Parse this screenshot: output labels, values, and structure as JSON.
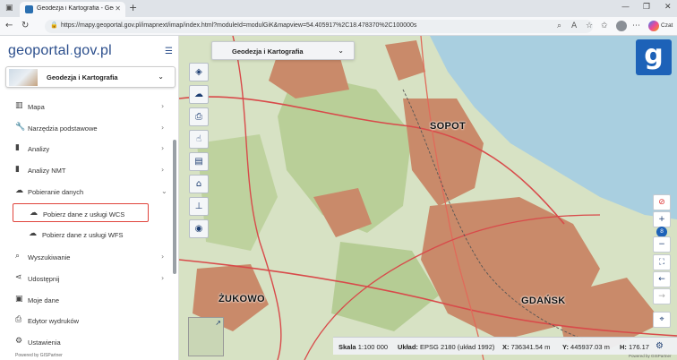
{
  "browser": {
    "tab_title": "Geodezja i Kartografia - Geoportal",
    "url": "https://mapy.geoportal.gov.pl/imapnext/imap/index.html?moduleId=modulGiK&mapview=54.405917%2C18.478370%2C100000s",
    "copilot_label": "Czat"
  },
  "sidebar": {
    "logo": {
      "main": "geoportal",
      "dot": ".",
      "rest": "gov.pl"
    },
    "profile_label": "Geodezja i Kartografia",
    "items": [
      {
        "label": "Mapa",
        "icon": "map-icon"
      },
      {
        "label": "Narzędzia podstawowe",
        "icon": "wrench-icon"
      },
      {
        "label": "Analizy",
        "icon": "bar-chart-icon"
      },
      {
        "label": "Analizy NMT",
        "icon": "bar-chart-icon"
      },
      {
        "label": "Pobieranie danych",
        "icon": "cloud-download-icon"
      },
      {
        "label": "Wyszukiwanie",
        "icon": "search-icon"
      },
      {
        "label": "Udostępnij",
        "icon": "share-icon"
      },
      {
        "label": "Moje dane",
        "icon": "save-icon"
      },
      {
        "label": "Edytor wydruków",
        "icon": "printer-icon"
      },
      {
        "label": "Ustawienia",
        "icon": "gear-icon"
      }
    ],
    "subitems": [
      {
        "label": "Pobierz dane z usługi WCS",
        "icon": "cloud-download-icon",
        "selected": true
      },
      {
        "label": "Pobierz dane z usługi WFS",
        "icon": "cloud-download-icon",
        "selected": false
      }
    ],
    "powered_by": "Powered by GISPartner"
  },
  "map": {
    "module_label": "Geodezja i Kartografia",
    "places": [
      "SOPOT",
      "ŻUKOWO",
      "GDAŃSK"
    ],
    "zoom_level": "8",
    "colors": {
      "urban": "#c98a6a",
      "forest": "#b9cf98",
      "water": "#a9cfe0",
      "road": "#d84a4a",
      "accent": "#1d62b8"
    }
  },
  "status": {
    "scale_label": "Skala",
    "scale_value": "1:100 000",
    "crs_label": "Układ:",
    "crs_value": "EPSG 2180 (układ 1992)",
    "x_label": "X:",
    "x_value": "736341.54 m",
    "y_label": "Y:",
    "y_value": "445937.03 m",
    "h_label": "H:",
    "h_value": "176.17",
    "powered_by": "Powered by GISPartner"
  }
}
